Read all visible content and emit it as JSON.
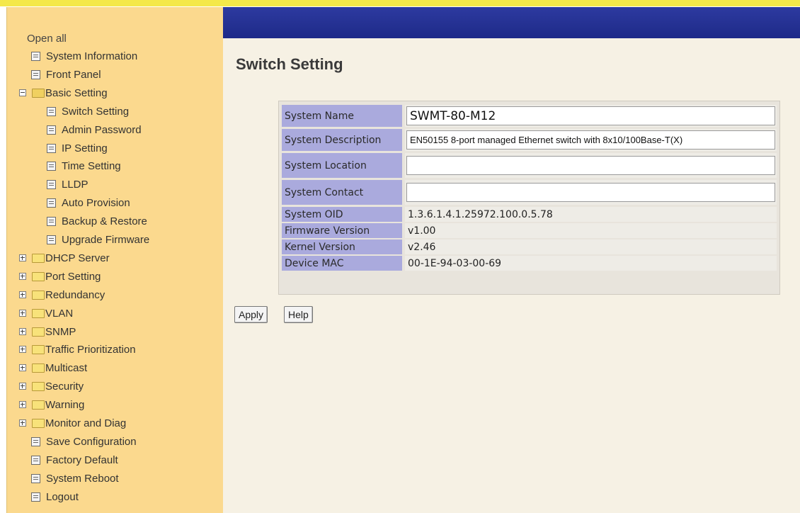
{
  "sidebar": {
    "open_all": "Open all",
    "items": [
      {
        "label": "System Information",
        "type": "page",
        "level": 1
      },
      {
        "label": "Front Panel",
        "type": "page",
        "level": 1
      },
      {
        "label": "Basic Setting",
        "type": "folder",
        "expanded": true,
        "level": 0
      },
      {
        "label": "Switch Setting",
        "type": "page",
        "level": 2
      },
      {
        "label": "Admin Password",
        "type": "page",
        "level": 2
      },
      {
        "label": "IP Setting",
        "type": "page",
        "level": 2
      },
      {
        "label": "Time Setting",
        "type": "page",
        "level": 2
      },
      {
        "label": "LLDP",
        "type": "page",
        "level": 2
      },
      {
        "label": "Auto Provision",
        "type": "page",
        "level": 2
      },
      {
        "label": "Backup & Restore",
        "type": "page",
        "level": 2
      },
      {
        "label": "Upgrade Firmware",
        "type": "page",
        "level": 2
      },
      {
        "label": "DHCP Server",
        "type": "folder",
        "expanded": false,
        "level": 0
      },
      {
        "label": "Port Setting",
        "type": "folder",
        "expanded": false,
        "level": 0
      },
      {
        "label": "Redundancy",
        "type": "folder",
        "expanded": false,
        "level": 0
      },
      {
        "label": "VLAN",
        "type": "folder",
        "expanded": false,
        "level": 0
      },
      {
        "label": "SNMP",
        "type": "folder",
        "expanded": false,
        "level": 0
      },
      {
        "label": "Traffic Prioritization",
        "type": "folder",
        "expanded": false,
        "level": 0
      },
      {
        "label": "Multicast",
        "type": "folder",
        "expanded": false,
        "level": 0
      },
      {
        "label": "Security",
        "type": "folder",
        "expanded": false,
        "level": 0
      },
      {
        "label": "Warning",
        "type": "folder",
        "expanded": false,
        "level": 0
      },
      {
        "label": "Monitor and Diag",
        "type": "folder",
        "expanded": false,
        "level": 0
      },
      {
        "label": "Save Configuration",
        "type": "page",
        "level": 1
      },
      {
        "label": "Factory Default",
        "type": "page",
        "level": 1
      },
      {
        "label": "System Reboot",
        "type": "page",
        "level": 1
      },
      {
        "label": "Logout",
        "type": "page",
        "level": 1
      }
    ]
  },
  "main": {
    "title": "Switch Setting",
    "rows": [
      {
        "label": "System Name",
        "kind": "input",
        "value": "SWMT-80-M12"
      },
      {
        "label": "System Description",
        "kind": "input",
        "value": "EN50155 8-port managed Ethernet switch with 8x10/100Base-T(X)"
      },
      {
        "label": "System Location",
        "kind": "input",
        "value": ""
      },
      {
        "label": "System Contact",
        "kind": "input",
        "value": ""
      },
      {
        "label": "System OID",
        "kind": "text",
        "value": "1.3.6.1.4.1.25972.100.0.5.78"
      },
      {
        "label": "Firmware Version",
        "kind": "text",
        "value": "v1.00"
      },
      {
        "label": "Kernel Version",
        "kind": "text",
        "value": "v2.46"
      },
      {
        "label": "Device MAC",
        "kind": "text",
        "value": "00-1E-94-03-00-69"
      }
    ],
    "buttons": {
      "apply": "Apply",
      "help": "Help"
    }
  },
  "colors": {
    "sidebar_bg": "#fbd98e",
    "top_bar": "#1e2a88",
    "label_cell": "#aaaadd",
    "page_bg": "#f6f1e4"
  }
}
